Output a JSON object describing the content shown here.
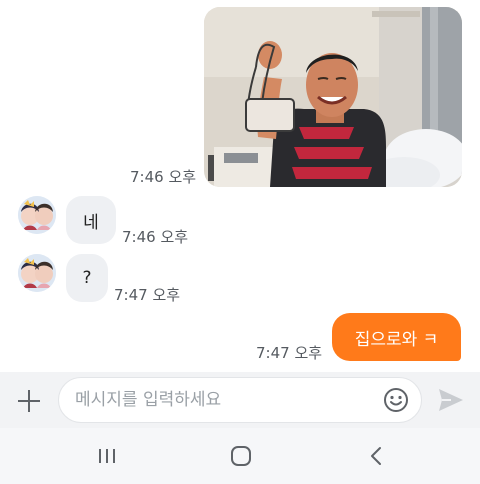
{
  "messages": [
    {
      "type": "photo",
      "direction": "outgoing",
      "time": "7:46 오후"
    },
    {
      "type": "text",
      "direction": "incoming",
      "text": "네",
      "time": "7:46 오후"
    },
    {
      "type": "text",
      "direction": "incoming",
      "text": "?",
      "time": "7:47 오후"
    },
    {
      "type": "text",
      "direction": "outgoing",
      "text": "집으로와 ㅋ",
      "time": "7:47 오후"
    }
  ],
  "composer": {
    "placeholder": "메시지를 입력하세요",
    "value": ""
  },
  "icons": {
    "attach": "plus-icon",
    "emoji": "smiley-icon",
    "send": "send-icon",
    "recents": "recent-apps-icon",
    "home": "home-icon",
    "back": "back-icon"
  },
  "colors": {
    "outgoing_bubble": "#ff7a1a",
    "incoming_bubble": "#eef0f3",
    "composer_bg": "#f2f3f5"
  }
}
